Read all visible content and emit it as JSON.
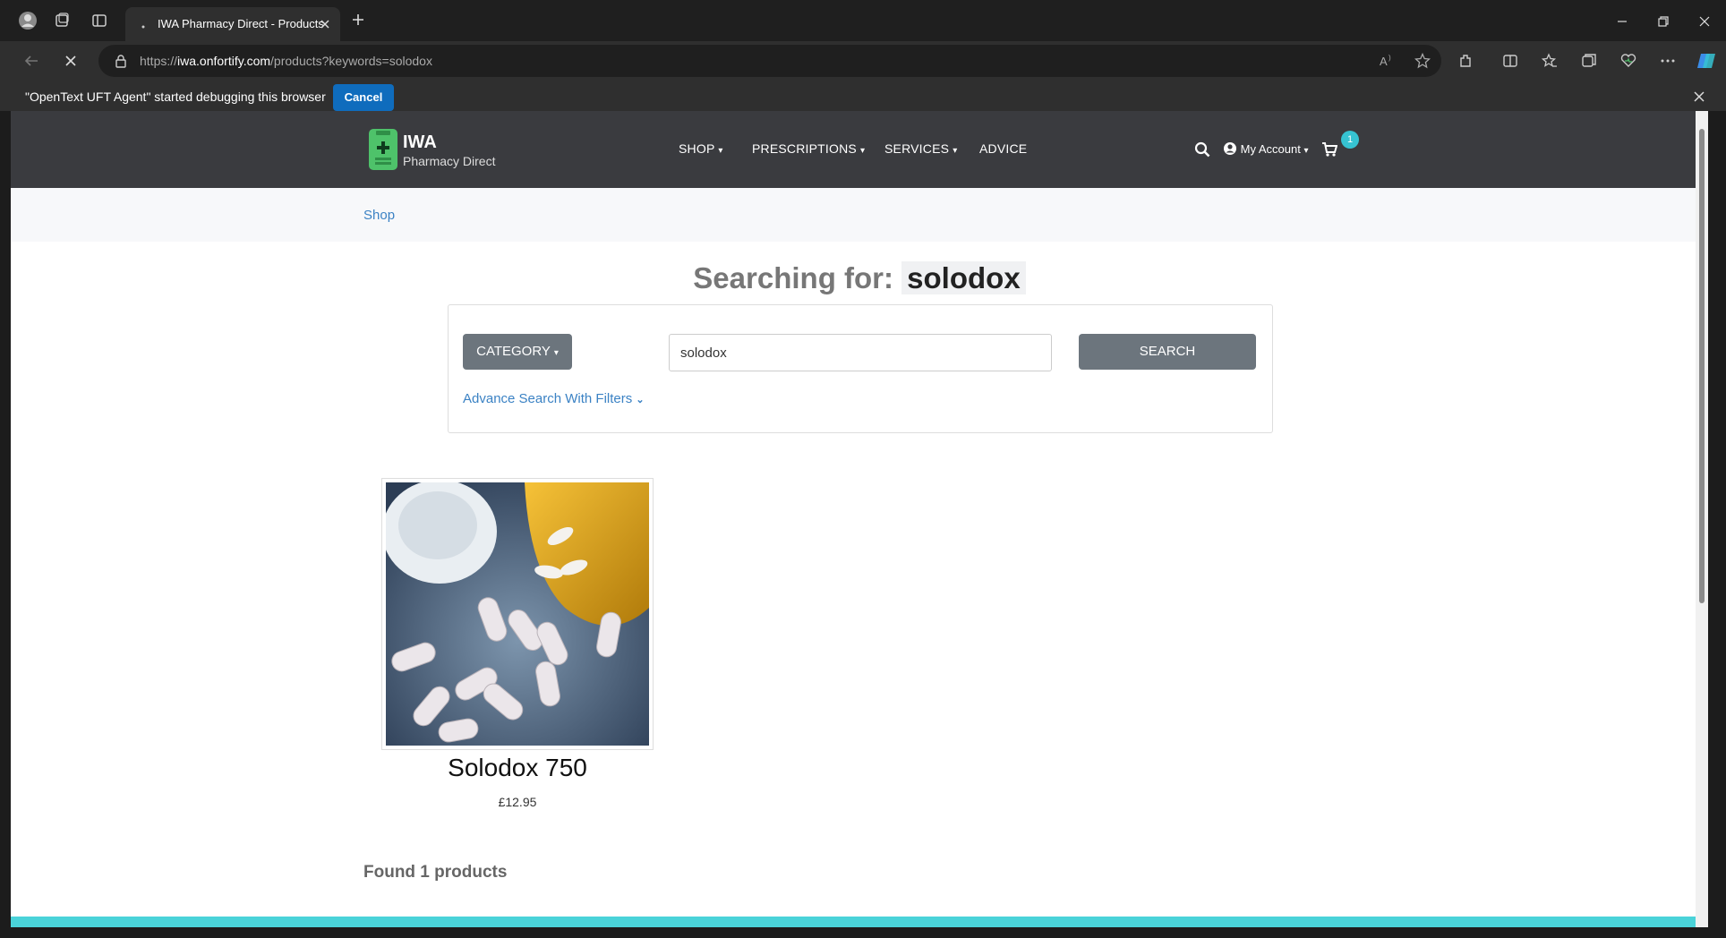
{
  "browser": {
    "tab_title": "IWA Pharmacy Direct - Products",
    "url_prefix": "https://",
    "url_host": "iwa.onfortify.com",
    "url_path": "/products?keywords=solodox"
  },
  "infobar": {
    "message": "\"OpenText UFT Agent\" started debugging this browser",
    "cancel_label": "Cancel"
  },
  "site": {
    "brand": "IWA",
    "brand_sub": "Pharmacy Direct",
    "nav": {
      "shop": "SHOP",
      "prescriptions": "PRESCRIPTIONS",
      "services": "SERVICES",
      "advice": "ADVICE"
    },
    "account_label": "My Account",
    "cart_count": "1"
  },
  "breadcrumb": {
    "shop": "Shop"
  },
  "search": {
    "title_prefix": "Searching for:",
    "term": "solodox",
    "category_label": "CATEGORY",
    "input_value": "solodox",
    "button_label": "SEARCH",
    "advance_label": "Advance Search With Filters"
  },
  "products": [
    {
      "name": "Solodox 750",
      "price": "£12.95"
    }
  ],
  "results": {
    "found_text": "Found 1 products"
  }
}
